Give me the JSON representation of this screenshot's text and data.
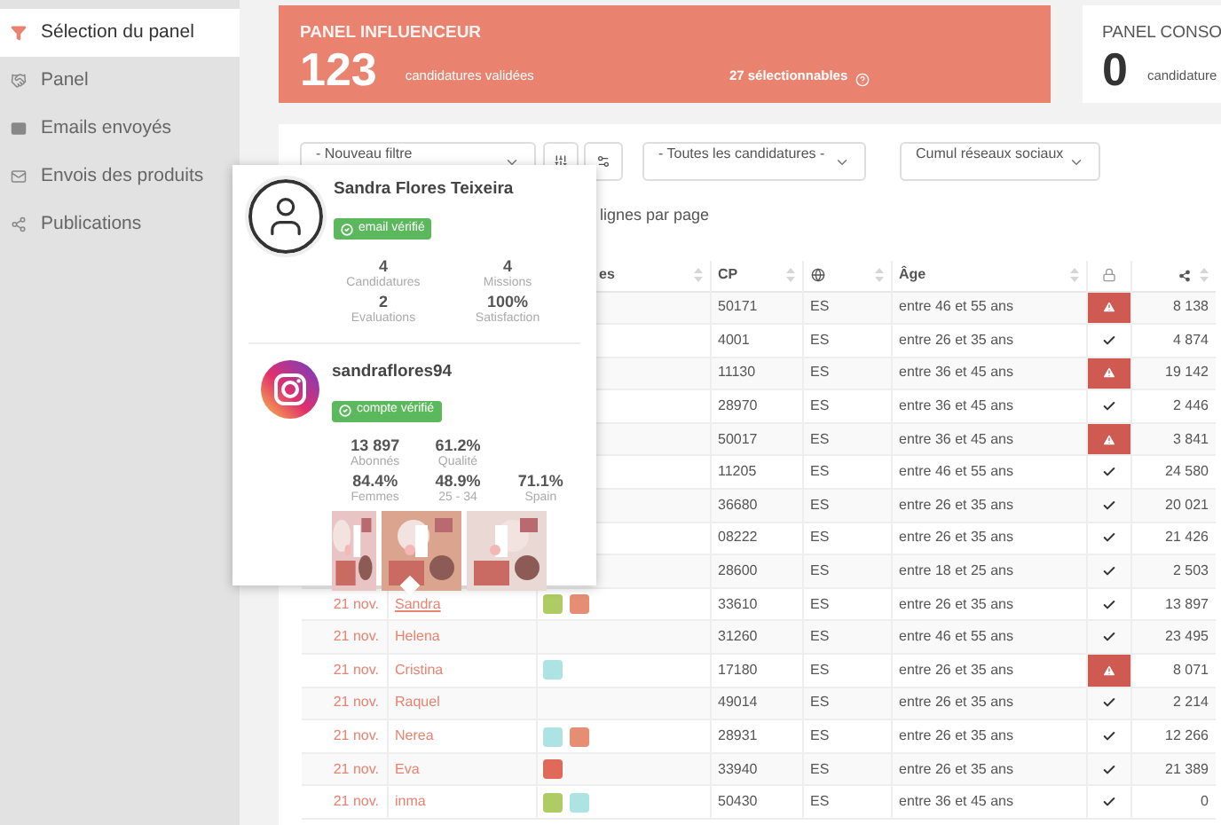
{
  "sidebar": {
    "items": [
      {
        "label": "Sélection du panel",
        "selected": true
      },
      {
        "label": "Panel",
        "selected": false
      },
      {
        "label": "Emails envoyés",
        "selected": false
      },
      {
        "label": "Envois des produits",
        "selected": false
      },
      {
        "label": "Publications",
        "selected": false
      }
    ]
  },
  "panel_influenceur": {
    "title": "PANEL INFLUENCEUR",
    "count": "123",
    "count_label": "candidatures validées",
    "selectable": "27 sélectionnables"
  },
  "panel_conso": {
    "title": "PANEL CONSO",
    "count": "0",
    "count_label": "candidature"
  },
  "filters": {
    "filter_select": "- Nouveau filtre",
    "status_select": "- Toutes les candidatures -",
    "network_select": "Cumul réseaux sociaux"
  },
  "page_size_label": "lignes par page",
  "table": {
    "columns": {
      "tags": "es",
      "cp": "CP",
      "age": "Âge"
    },
    "rows": [
      {
        "cp": "50171",
        "country": "ES",
        "age": "entre 46 et 55 ans",
        "alert": true,
        "reach": "8 138"
      },
      {
        "cp": "4001",
        "country": "ES",
        "age": "entre 26 et 35 ans",
        "alert": false,
        "reach": "4 874"
      },
      {
        "cp": "11130",
        "country": "ES",
        "age": "entre 36 et 45 ans",
        "alert": true,
        "reach": "19 142"
      },
      {
        "cp": "28970",
        "country": "ES",
        "age": "entre 36 et 45 ans",
        "alert": false,
        "reach": "2 446"
      },
      {
        "cp": "50017",
        "country": "ES",
        "age": "entre 36 et 45 ans",
        "alert": true,
        "reach": "3 841"
      },
      {
        "cp": "11205",
        "country": "ES",
        "age": "entre 46 et 55 ans",
        "alert": false,
        "reach": "24 580"
      },
      {
        "cp": "36680",
        "country": "ES",
        "age": "entre 26 et 35 ans",
        "alert": false,
        "reach": "20 021"
      },
      {
        "cp": "08222",
        "country": "ES",
        "age": "entre 26 et 35 ans",
        "alert": false,
        "reach": "21 426"
      },
      {
        "cp": "28600",
        "country": "ES",
        "age": "entre 18 et 25 ans",
        "alert": false,
        "reach": "2 503"
      },
      {
        "date": "21 nov.",
        "name": "Sandra",
        "hovered": true,
        "tags": [
          {
            "color": "#afcb63"
          },
          {
            "color": "#e58e74"
          }
        ],
        "cp": "33610",
        "country": "ES",
        "age": "entre 26 et 35 ans",
        "alert": false,
        "reach": "13 897"
      },
      {
        "date": "21 nov.",
        "name": "Helena",
        "hovered": false,
        "cp": "31260",
        "country": "ES",
        "age": "entre 46 et 55 ans",
        "alert": false,
        "reach": "23 495"
      },
      {
        "date": "21 nov.",
        "name": "Cristina",
        "hovered": false,
        "tags": [
          {
            "color": "#ade3e2"
          }
        ],
        "cp": "17180",
        "country": "ES",
        "age": "entre 26 et 35 ans",
        "alert": true,
        "reach": "8 071"
      },
      {
        "date": "21 nov.",
        "name": "Raquel",
        "hovered": false,
        "cp": "49014",
        "country": "ES",
        "age": "entre 26 et 35 ans",
        "alert": false,
        "reach": "2 214"
      },
      {
        "date": "21 nov.",
        "name": "Nerea",
        "hovered": false,
        "tags": [
          {
            "color": "#ade3e2"
          },
          {
            "color": "#e58e74"
          }
        ],
        "cp": "28931",
        "country": "ES",
        "age": "entre 26 et 35 ans",
        "alert": false,
        "reach": "12 266"
      },
      {
        "date": "21 nov.",
        "name": "Eva",
        "hovered": false,
        "tags": [
          {
            "color": "#e06a5a"
          }
        ],
        "cp": "33940",
        "country": "ES",
        "age": "entre 26 et 35 ans",
        "alert": false,
        "reach": "21 389"
      },
      {
        "date": "21 nov.",
        "name": "inma",
        "hovered": false,
        "tags": [
          {
            "color": "#afcb63"
          },
          {
            "color": "#ade3e2"
          }
        ],
        "cp": "50430",
        "country": "ES",
        "age": "entre 36 et 45 ans",
        "alert": false,
        "reach": "0"
      }
    ]
  },
  "popover": {
    "name": "Sandra Flores Teixeira",
    "email_badge": "email vérifié",
    "stats": [
      {
        "value": "4",
        "label": "Candidatures"
      },
      {
        "value": "4",
        "label": "Missions"
      },
      {
        "value": "2",
        "label": "Evaluations"
      },
      {
        "value": "100%",
        "label": "Satisfaction"
      }
    ],
    "instagram": {
      "handle": "sandraflores94",
      "badge": "compte vérifié",
      "stat_rows": [
        [
          {
            "value": "13 897",
            "label": "Abonnés"
          },
          {
            "value": "61.2%",
            "label": "Qualité"
          }
        ],
        [
          {
            "value": "84.4%",
            "label": "Femmes"
          },
          {
            "value": "48.9%",
            "label": "25 - 34"
          },
          {
            "value": "71.1%",
            "label": "Spain"
          }
        ]
      ],
      "photos": [
        {
          "kind": "picture"
        },
        {
          "kind": "picture"
        },
        {
          "kind": "picture"
        }
      ]
    }
  }
}
